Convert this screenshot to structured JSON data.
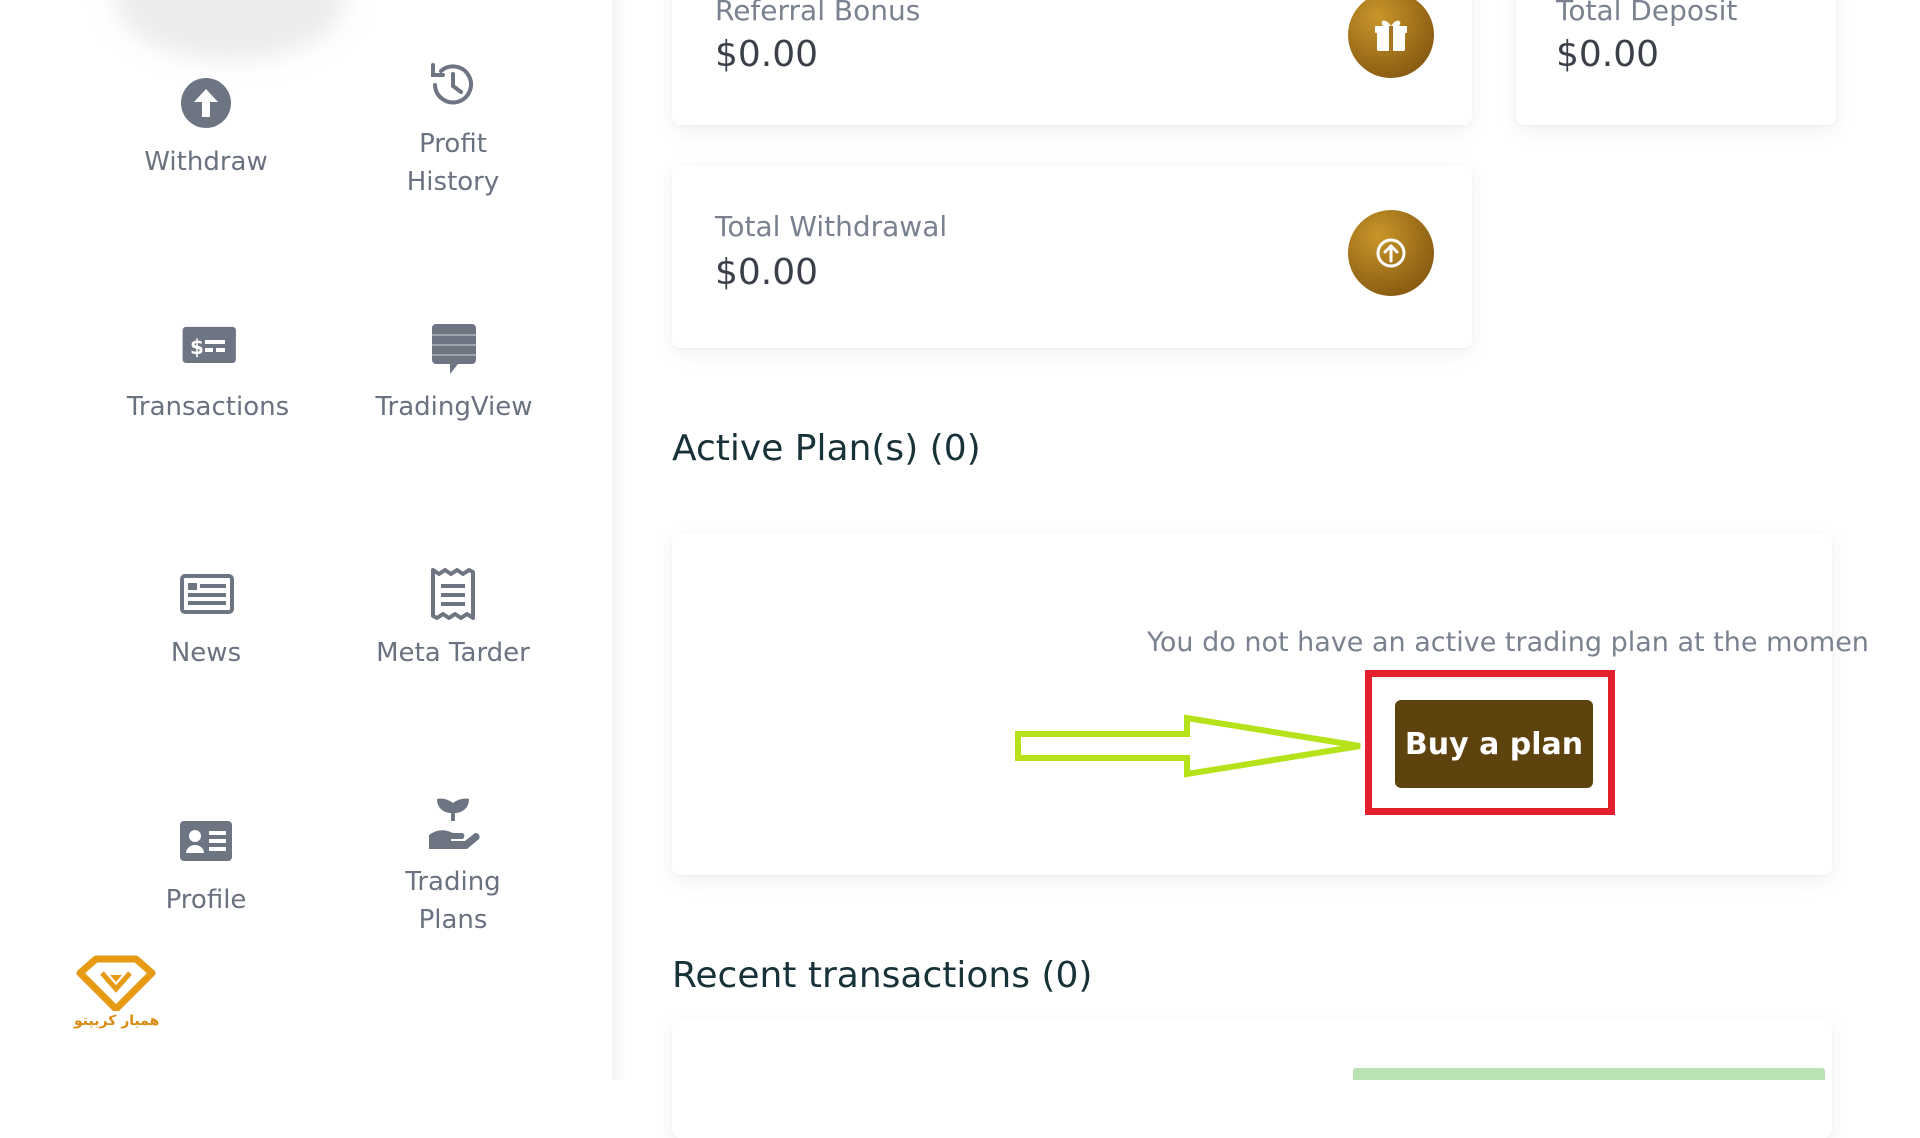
{
  "sidebar": {
    "items": [
      {
        "label": "Withdraw",
        "icon": "arrow-up-circle-icon"
      },
      {
        "label": "Profit",
        "label2": "History",
        "icon": "history-icon"
      },
      {
        "label": "Transactions",
        "icon": "money-bill-icon"
      },
      {
        "label": "TradingView",
        "icon": "chat-bubble-icon"
      },
      {
        "label": "News",
        "icon": "newspaper-icon"
      },
      {
        "label": "Meta Tarder",
        "icon": "receipt-icon"
      },
      {
        "label": "Profile",
        "icon": "id-card-icon"
      },
      {
        "label": "Trading",
        "label2": "Plans",
        "icon": "seedling-hand-icon"
      }
    ]
  },
  "stats": {
    "referral_bonus": {
      "label": "Referral Bonus",
      "value": "$0.00",
      "icon": "gift-icon"
    },
    "total_deposit": {
      "label": "Total Deposit",
      "value": "$0.00"
    },
    "total_withdrawal": {
      "label": "Total Withdrawal",
      "value": "$0.00",
      "icon": "arrow-up-circle-icon"
    }
  },
  "active_plans": {
    "title": "Active Plan(s) (0)",
    "empty_message": "You do not have an active trading plan at the momen",
    "buy_button": "Buy a plan"
  },
  "recent_transactions": {
    "title": "Recent transactions (0)"
  },
  "watermark": {
    "logo_text": "همیار کریپتو"
  },
  "colors": {
    "accent_gold": "#8a5d12",
    "button_brown": "#5e430e",
    "highlight_red": "#e3202d",
    "annotation_arrow": "#b6e21a",
    "title_text": "#18323a"
  }
}
